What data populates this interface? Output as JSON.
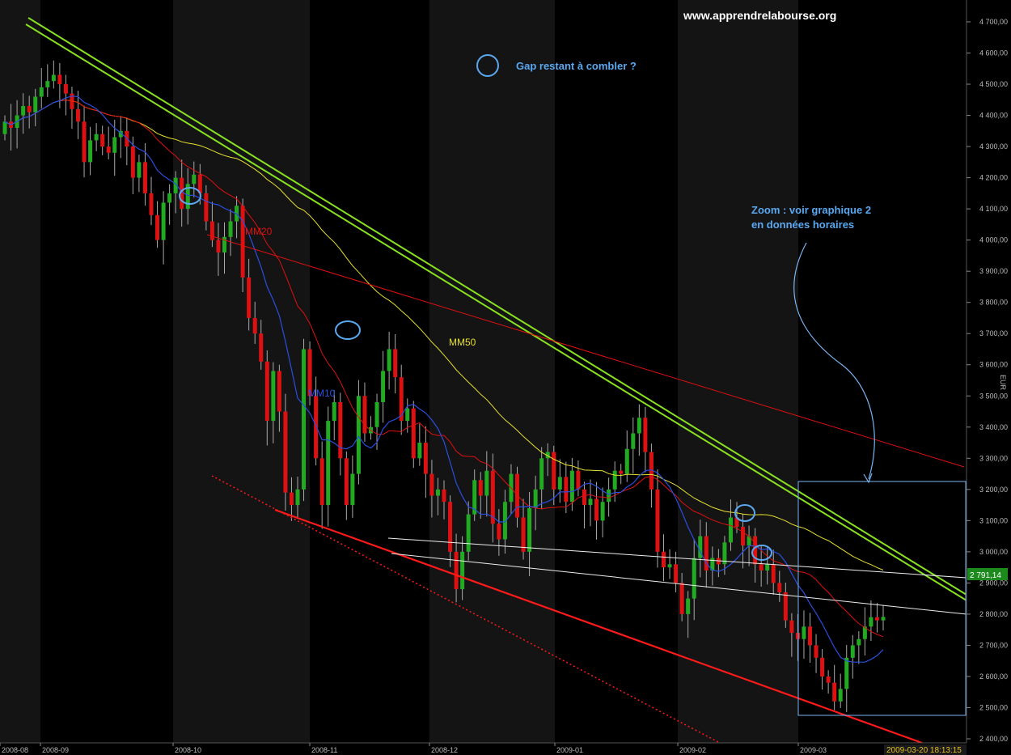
{
  "watermark": "www.apprendrelabourse.org",
  "currency_label": "EUR",
  "last_price": "2 791,14",
  "timestamp": "2009-03-20 18:13:15",
  "annotations": {
    "gap": "Gap restant à combler ?",
    "zoom_line1": "Zoom : voir graphique 2",
    "zoom_line2": "en données horaires",
    "mm10": "MM10",
    "mm20": "MM20",
    "mm50": "MM50"
  },
  "colors": {
    "background": "#000000",
    "band_dark": "#000000",
    "band_light": "#141414",
    "up_candle": "#22aa22",
    "down_candle": "#dd1111",
    "mm10": "#2a4fe0",
    "mm20": "#e01010",
    "mm50": "#e6e030",
    "trend_green": "#88e020",
    "annotation_blue": "#5aa8f0",
    "price_badge": "#1d8a1d"
  },
  "chart_data": {
    "type": "candlestick",
    "title": "",
    "ylabel": "EUR",
    "ylim": [
      2400,
      4700
    ],
    "y_ticks": [
      "2 400,00",
      "2 500,00",
      "2 600,00",
      "2 700,00",
      "2 800,00",
      "2 900,00",
      "3 000,00",
      "3 100,00",
      "3 200,00",
      "3 300,00",
      "3 400,00",
      "3 500,00",
      "3 600,00",
      "3 700,00",
      "3 800,00",
      "3 900,00",
      "4 000,00",
      "4 100,00",
      "4 200,00",
      "4 300,00",
      "4 400,00",
      "4 500,00",
      "4 600,00",
      "4 700,00"
    ],
    "x_ticks": [
      "2008-08",
      "2008-09",
      "2008-10",
      "2008-11",
      "2008-12",
      "2009-01",
      "2009-02",
      "2009-03"
    ],
    "series": [
      {
        "name": "MM10",
        "type": "moving_average"
      },
      {
        "name": "MM20",
        "type": "moving_average"
      },
      {
        "name": "MM50",
        "type": "moving_average"
      }
    ],
    "last_value": 2791.14
  }
}
